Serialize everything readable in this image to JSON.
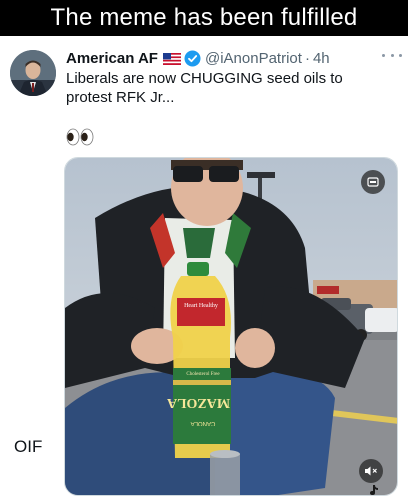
{
  "meme": {
    "caption": "The meme has been fulfilled",
    "side_label": "OIF"
  },
  "tweet": {
    "display_name": "American AF",
    "handle": "@iAnonPatriot",
    "separator": "·",
    "time": "4h",
    "text": "Liberals are now CHUGGING seed oils to protest RFK Jr...",
    "emoji": "eyes-emoji"
  },
  "media": {
    "bottle_brand": "MAZOLA",
    "bottle_top_label": "Heart Healthy",
    "bottle_sub_label": "Cholesterol Free",
    "bottle_bottom_label": "CANOLA"
  },
  "icons": [
    "flag-icon",
    "verified-icon",
    "more-icon",
    "gif-icon",
    "mute-icon",
    "tiktok-icon",
    "eyes-emoji"
  ],
  "colors": {
    "verified": "#1d9bf0",
    "caption_bg": "#000000",
    "text": "#0f1419",
    "muted": "#536471"
  }
}
